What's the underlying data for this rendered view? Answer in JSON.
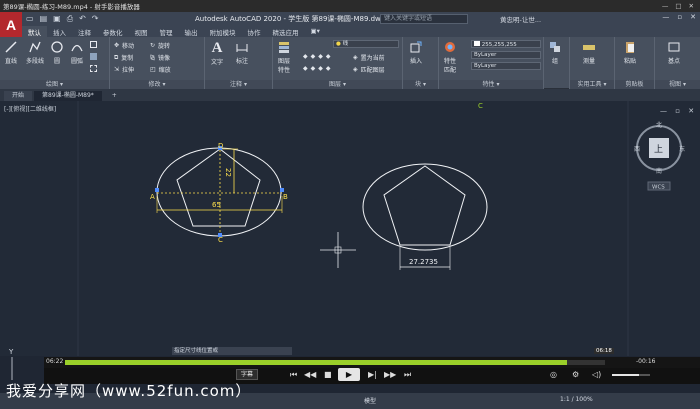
{
  "player": {
    "title": "第89课-椭圆-练习-M89.mp4 - 射手影音播放器",
    "controls": [
      "—",
      "□",
      "✕"
    ]
  },
  "acad": {
    "logo": "A",
    "title": "Autodesk AutoCAD 2020 - 学生版   第89课-椭圆-M89.dwg",
    "search_placeholder": "键入关键字或短语",
    "user": "黄忠明-让世...",
    "tabs": [
      "默认",
      "插入",
      "注释",
      "参数化",
      "视图",
      "管理",
      "输出",
      "附加模块",
      "协作",
      "精选应用",
      "▣▾"
    ],
    "panels": {
      "draw": {
        "label": "绘图 ▾",
        "line": "直线",
        "polyline": "多段线",
        "circle": "圆",
        "arc": "圆弧"
      },
      "modify": {
        "label": "修改 ▾",
        "move": "移动",
        "rotate": "旋转",
        "copy": "复制",
        "mirror": "镜像",
        "stretch": "拉伸",
        "scale": "缩放"
      },
      "annotation": {
        "label": "注释 ▾",
        "text": "文字",
        "dim": "标注"
      },
      "layers": {
        "label": "图层 ▾",
        "layer_props": "图层\n特性",
        "layer_combo": "线",
        "set_current": "置为当前",
        "match_layer": "匹配图层"
      },
      "block": {
        "label": "块 ▾",
        "insert": "插入"
      },
      "properties": {
        "label": "特性 ▾",
        "match": "特性\n匹配",
        "color": "255,255,255",
        "linetype": "ByLayer",
        "lineweight": "ByLayer"
      },
      "groups": {
        "label": "",
        "group": "组"
      },
      "utilities": {
        "label": "实用工具 ▾",
        "measure": "测量"
      },
      "clipboard": {
        "label": "剪贴板",
        "paste": "粘贴"
      },
      "view": {
        "label": "视图 ▾",
        "base": "基点"
      }
    },
    "doc_tabs": [
      "开始",
      "第89课-椭圆-M89*",
      "+"
    ],
    "view_label": "[-][俯视][二维线框]",
    "compass": {
      "top": "北",
      "face": "上",
      "left": "西",
      "right": "东",
      "bottom": "南",
      "wcs": "WCS"
    },
    "drawing": {
      "left_dims": {
        "D": "D",
        "A": "A",
        "B": "B",
        "C": "C",
        "width": "65",
        "height": "22"
      },
      "right_dim": "27.2735",
      "center_mark": "C"
    },
    "command_text": "指定尺寸线位置或",
    "axis_y": "Y",
    "status_model": "模型",
    "status_scale": "1:1 / 100%"
  },
  "playback": {
    "current": "06:22",
    "remaining": "-00:16",
    "popup": "06:18",
    "progress": 0.93,
    "volume": 0.7,
    "subtitle_btn": "字幕"
  },
  "watermark": "我爱分享网（www.52fun.com）"
}
